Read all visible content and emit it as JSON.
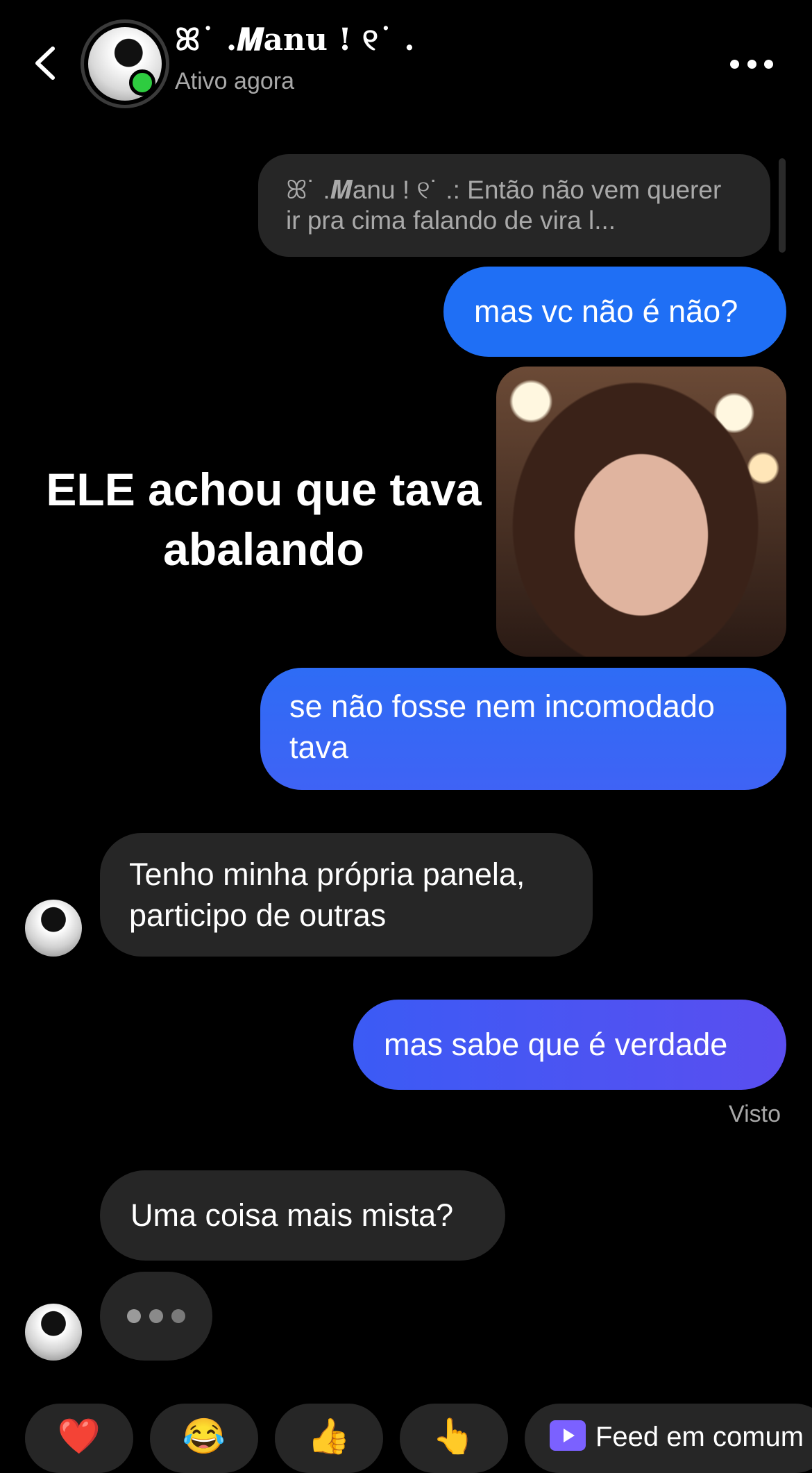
{
  "header": {
    "contact_name": "ꕤ˙ .𝑴anu ! ୧˙ .",
    "status": "Ativo agora"
  },
  "messages": {
    "reply_preview": "ꕤ˙ .𝑴anu ! ୧˙ .: Então não vem querer ir pra cima falando de vira l...",
    "out_1": "mas vc não é não?",
    "meme_caption": "ELE achou que tava abalando",
    "out_2": "se não fosse nem incomodado tava",
    "in_1": "Tenho minha própria panela, participo de outras",
    "out_3": "mas sabe que é verdade",
    "seen": "Visto",
    "in_2": "Uma coisa mais mista?"
  },
  "quick_replies": {
    "heart": "❤️",
    "laugh": "😂",
    "thumbs": "👍",
    "point": "👆",
    "feed_label": "Feed em comum"
  },
  "colors": {
    "outgoing": "#1f6ff5",
    "incoming": "#262626",
    "online": "#2ecc40"
  }
}
